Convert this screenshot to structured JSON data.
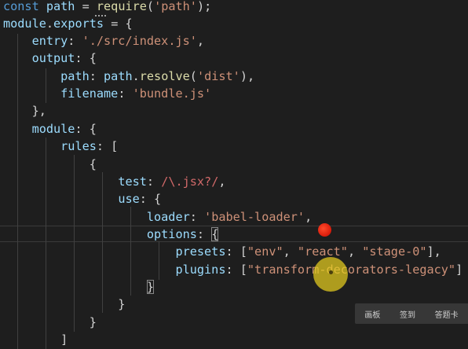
{
  "editor": {
    "lines": [
      [
        [
          "kw",
          "const"
        ],
        [
          "p",
          " "
        ],
        [
          "var",
          "path"
        ],
        [
          "p",
          " = "
        ],
        [
          "fn",
          "require"
        ],
        [
          "p",
          "("
        ],
        [
          "str",
          "'path'"
        ],
        [
          "p",
          ");"
        ]
      ],
      [
        [
          "var",
          "module"
        ],
        [
          "p",
          "."
        ],
        [
          "var",
          "exports"
        ],
        [
          "p",
          " = {"
        ]
      ],
      [
        [
          "p",
          "    "
        ],
        [
          "var",
          "entry"
        ],
        [
          "p",
          ": "
        ],
        [
          "str",
          "'./src/index.js'"
        ],
        [
          "p",
          ","
        ]
      ],
      [
        [
          "p",
          "    "
        ],
        [
          "var",
          "output"
        ],
        [
          "p",
          ": {"
        ]
      ],
      [
        [
          "p",
          "        "
        ],
        [
          "var",
          "path"
        ],
        [
          "p",
          ": "
        ],
        [
          "var",
          "path"
        ],
        [
          "p",
          "."
        ],
        [
          "fn",
          "resolve"
        ],
        [
          "p",
          "("
        ],
        [
          "str",
          "'dist'"
        ],
        [
          "p",
          "),"
        ]
      ],
      [
        [
          "p",
          "        "
        ],
        [
          "var",
          "filename"
        ],
        [
          "p",
          ": "
        ],
        [
          "str",
          "'bundle.js'"
        ]
      ],
      [
        [
          "p",
          "    },"
        ]
      ],
      [
        [
          "p",
          "    "
        ],
        [
          "var",
          "module"
        ],
        [
          "p",
          ": {"
        ]
      ],
      [
        [
          "p",
          "        "
        ],
        [
          "var",
          "rules"
        ],
        [
          "p",
          ": ["
        ]
      ],
      [
        [
          "p",
          "            {"
        ]
      ],
      [
        [
          "p",
          "                "
        ],
        [
          "var",
          "test"
        ],
        [
          "p",
          ": "
        ],
        [
          "re",
          "/\\.jsx?/"
        ],
        [
          "p",
          ","
        ]
      ],
      [
        [
          "p",
          "                "
        ],
        [
          "var",
          "use"
        ],
        [
          "p",
          ": {"
        ]
      ],
      [
        [
          "p",
          "                    "
        ],
        [
          "var",
          "loader"
        ],
        [
          "p",
          ": "
        ],
        [
          "str",
          "'babel-loader'"
        ],
        [
          "p",
          ","
        ]
      ],
      [
        [
          "p",
          "                    "
        ],
        [
          "var",
          "options"
        ],
        [
          "p",
          ": "
        ],
        [
          "match",
          "{"
        ]
      ],
      [
        [
          "p",
          "                        "
        ],
        [
          "var",
          "presets"
        ],
        [
          "p",
          ": ["
        ],
        [
          "str",
          "\"env\""
        ],
        [
          "p",
          ", "
        ],
        [
          "str",
          "\"react\""
        ],
        [
          "p",
          ", "
        ],
        [
          "str",
          "\"stage-0\""
        ],
        [
          "p",
          "],"
        ]
      ],
      [
        [
          "p",
          "                        "
        ],
        [
          "var",
          "plugins"
        ],
        [
          "p",
          ": ["
        ],
        [
          "str",
          "\"transform-decorators-legacy\""
        ],
        [
          "p",
          "]"
        ]
      ],
      [
        [
          "p",
          "                    "
        ],
        [
          "match",
          "}"
        ]
      ],
      [
        [
          "p",
          "                }"
        ]
      ],
      [
        [
          "p",
          "            }"
        ]
      ],
      [
        [
          "p",
          "        ]"
        ]
      ]
    ]
  },
  "toolbar": {
    "item1": "画板",
    "item2": "签到",
    "item3": "答题卡"
  }
}
